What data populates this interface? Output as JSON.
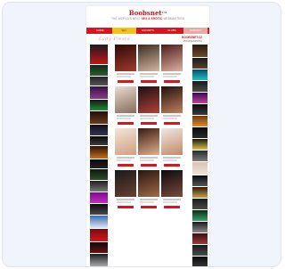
{
  "site": {
    "logo_text": "Boobsnet",
    "logo_mark": "TM",
    "tagline_pre": "THE WORLD'S BEST",
    "tagline_hl": "SEX & EROTIC",
    "tagline_post": "WEBMASTERS"
  },
  "nav": {
    "items": [
      {
        "label": "HOME",
        "state": "default"
      },
      {
        "label": "SEX",
        "state": "active"
      },
      {
        "label": "ESCORTS",
        "state": "default"
      },
      {
        "label": "CLUBS",
        "state": "default"
      },
      {
        "label": "CONTACT",
        "state": "pink"
      }
    ]
  },
  "banner": {
    "script_text": "Lady Fiesta",
    "brand_text": "BOOBSNET.CZ",
    "sub_text": "PRIVATE EROTIC"
  },
  "colors": {
    "brand_red": "#d6161f",
    "nav_active": "#f4c21a",
    "page_bg": "#f1f4fa"
  },
  "ads_left": [
    {
      "top": "#1c1c1c",
      "bottom": "#c4141a",
      "h": 22
    },
    {
      "top": "#0d2a18",
      "bottom": "#2f5a30",
      "h": 12
    },
    {
      "top": "#222222",
      "bottom": "#555555",
      "h": 10
    },
    {
      "top": "#3a0f4a",
      "bottom": "#8a3a8a",
      "h": 14
    },
    {
      "top": "#101a10",
      "bottom": "#1f8a3a",
      "h": 12
    },
    {
      "top": "#201008",
      "bottom": "#6a3a1a",
      "h": 14
    },
    {
      "top": "#101018",
      "bottom": "#333355",
      "h": 12
    },
    {
      "top": "#0a0a0a",
      "bottom": "#3a3a3a",
      "h": 10
    },
    {
      "top": "#2a1008",
      "bottom": "#c7701a",
      "h": 14
    },
    {
      "top": "#0a0a0a",
      "bottom": "#222",
      "h": 10
    },
    {
      "top": "#0d1a0d",
      "bottom": "#2d4a2d",
      "h": 12
    },
    {
      "top": "#202020",
      "bottom": "#777777",
      "h": 12
    },
    {
      "top": "#7a0a8a",
      "bottom": "#c030c0",
      "h": 12
    },
    {
      "top": "#0a0a0a",
      "bottom": "#4a4a4a",
      "h": 12
    },
    {
      "top": "#3a6ab0",
      "bottom": "#dfe8f5",
      "h": 14
    },
    {
      "top": "#7a0a0a",
      "bottom": "#d4161d",
      "h": 14
    },
    {
      "top": "#0a0a0a",
      "bottom": "#6a1010",
      "h": 12
    },
    {
      "top": "#1a1a1a",
      "bottom": "#aaaaaa",
      "h": 14
    }
  ],
  "ads_right": [
    {
      "top": "#2a1a10",
      "bottom": "#6a4a2a",
      "h": 14
    },
    {
      "top": "#1a1a1a",
      "bottom": "#5a4030",
      "h": 12
    },
    {
      "top": "#0a4a6a",
      "bottom": "#19c4c4",
      "h": 12
    },
    {
      "top": "#1a1a1a",
      "bottom": "#4a4a4a",
      "h": 12
    },
    {
      "top": "#3a0a4a",
      "bottom": "#c040a0",
      "h": 12
    },
    {
      "top": "#0a0a0a",
      "bottom": "#3a3a3a",
      "h": 12
    },
    {
      "top": "#6a3a10",
      "bottom": "#dc8a2a",
      "h": 12
    },
    {
      "top": "#0a0a0a",
      "bottom": "#2a2a2a",
      "h": 12
    },
    {
      "top": "#1a1a0a",
      "bottom": "#d8c050",
      "h": 12
    },
    {
      "top": "#2a2a2a",
      "bottom": "#7a7a7a",
      "h": 12
    },
    {
      "top": "#d8c4b0",
      "bottom": "#efe3d6",
      "h": 14
    },
    {
      "top": "#0a0a0a",
      "bottom": "#555555",
      "h": 12
    },
    {
      "top": "#2a1a0a",
      "bottom": "#c9a24a",
      "h": 12
    },
    {
      "top": "#1a1a1a",
      "bottom": "#4a4a4a",
      "h": 12
    },
    {
      "top": "#0a2a1a",
      "bottom": "#3aa06a",
      "h": 12
    },
    {
      "top": "#1a1a1a",
      "bottom": "#8a8a8a",
      "h": 12
    },
    {
      "top": "#3a1010",
      "bottom": "#9a3a3a",
      "h": 12
    },
    {
      "top": "#1a1a1a",
      "bottom": "#4a4a4a",
      "h": 12
    },
    {
      "top": "#0a0a0a",
      "bottom": "#3a3a3a",
      "h": 12
    }
  ],
  "tiles": [
    {
      "photo": [
        "#2a0a0a",
        "#a23a2a"
      ]
    },
    {
      "photo": [
        "#3a2a20",
        "#d3b7a0"
      ]
    },
    {
      "photo": [
        "#4a1a1a",
        "#e0b0a0"
      ]
    },
    {
      "photo": [
        "#e8dcd0",
        "#8a6a5a"
      ]
    },
    {
      "photo": [
        "#1a1010",
        "#b0403a"
      ]
    },
    {
      "photo": [
        "#20100a",
        "#c08060"
      ]
    },
    {
      "photo": [
        "#f2e4da",
        "#d0a080"
      ]
    },
    {
      "photo": [
        "#3a1a10",
        "#e0b090"
      ]
    },
    {
      "photo": [
        "#f0e8e0",
        "#c08a6a"
      ]
    },
    {
      "photo": [
        "#1a1a1a",
        "#6a4030"
      ]
    },
    {
      "photo": [
        "#2a1410",
        "#a06a4a"
      ]
    },
    {
      "photo": [
        "#0a0a0a",
        "#7a4a40"
      ]
    }
  ]
}
